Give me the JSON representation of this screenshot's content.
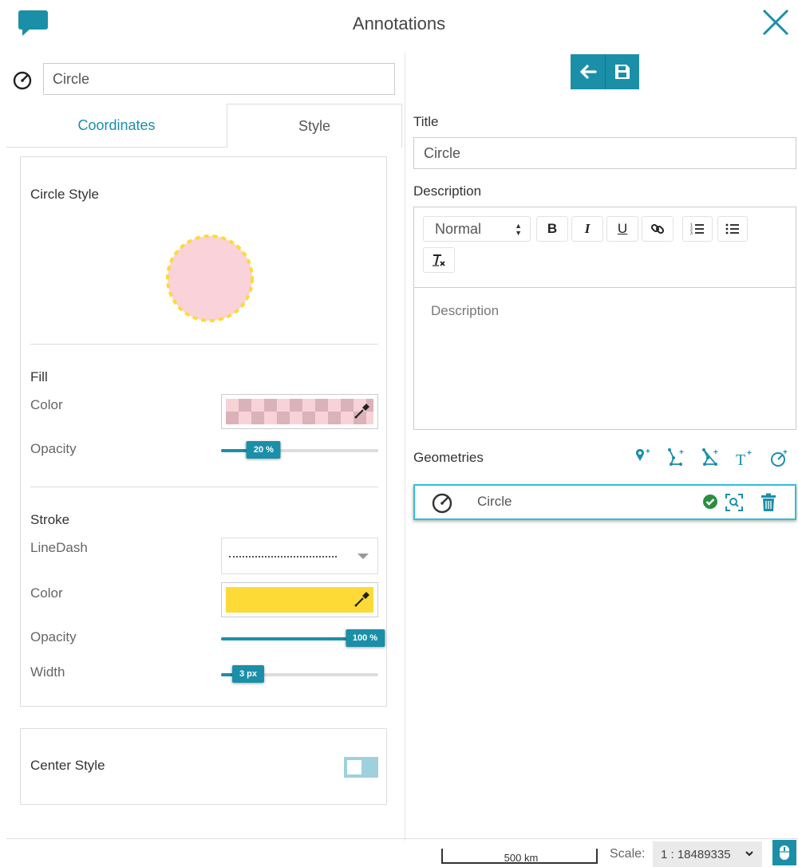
{
  "header": {
    "title": "Annotations",
    "logo_icon": "comment-icon",
    "close_icon": "close-icon"
  },
  "left": {
    "name_value": "Circle",
    "name_icon": "circle-geometry-icon",
    "tabs": [
      {
        "label": "Coordinates",
        "active": false
      },
      {
        "label": "Style",
        "active": true
      }
    ],
    "style_card": {
      "heading": "Circle Style",
      "preview": {
        "fill_color": "#f9d3d9",
        "stroke_color": "#fdda36"
      },
      "fill": {
        "title": "Fill",
        "color_label": "Color",
        "color": "#f4b6c2",
        "opacity_label": "Opacity",
        "opacity_value": 0.2,
        "opacity_text": "20 %"
      },
      "stroke": {
        "title": "Stroke",
        "linedash_label": "LineDash",
        "color_label": "Color",
        "color": "#fdda36",
        "opacity_label": "Opacity",
        "opacity_value": 1.0,
        "opacity_text": "100 %",
        "width_label": "Width",
        "width_value": 0.05,
        "width_text": "3 px"
      }
    },
    "center_style": {
      "label": "Center Style",
      "enabled": false
    }
  },
  "right": {
    "toolbar_icons": [
      "arrow-left-icon",
      "save-icon"
    ],
    "title_label": "Title",
    "title_value": "Circle",
    "description_label": "Description",
    "editor": {
      "format_value": "Normal",
      "bold_label": "B",
      "italic_label": "I",
      "underline_label": "U",
      "link_icon": "link-icon",
      "ordered_list_icon": "ordered-list-icon",
      "bullet_list_icon": "bullet-list-icon",
      "clear_format_icon": "clear-format-icon",
      "placeholder": "Description"
    },
    "geometries_label": "Geometries",
    "geometry_add_icons": [
      "add-marker-icon",
      "add-line-icon",
      "add-polygon-icon",
      "add-text-icon",
      "add-circle-icon"
    ],
    "geometry_item": {
      "label": "Circle",
      "icon": "circle-geometry-icon",
      "valid_icon": "check-circle-icon",
      "zoom_icon": "zoom-to-icon",
      "delete_icon": "trash-icon"
    }
  },
  "footer": {
    "scalebar_text": "500 km",
    "scale_label": "Scale:",
    "scale_value": "1 : 18489335",
    "mouse_icon": "mouse-icon"
  },
  "colors": {
    "accent": "#1b8fa8",
    "accent_light": "#31c0d8",
    "valid_green": "#2a8f3f"
  }
}
